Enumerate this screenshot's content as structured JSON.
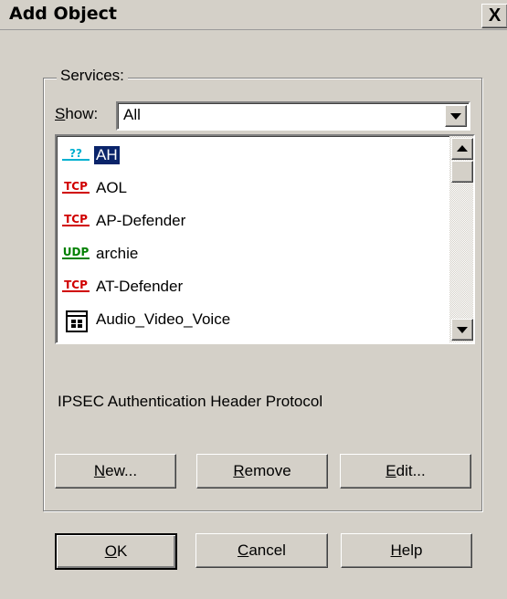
{
  "window": {
    "title": "Add Object",
    "close_label": "X"
  },
  "group": {
    "label": "Services:"
  },
  "show": {
    "label_underlined": "S",
    "label_rest": "how:",
    "value": "All"
  },
  "list": {
    "items": [
      {
        "proto": "??",
        "kind": "unk",
        "label": "AH",
        "selected": true
      },
      {
        "proto": "TCP",
        "kind": "tcp",
        "label": "AOL"
      },
      {
        "proto": "TCP",
        "kind": "tcp",
        "label": "AP-Defender"
      },
      {
        "proto": "UDP",
        "kind": "udp",
        "label": "archie"
      },
      {
        "proto": "TCP",
        "kind": "tcp",
        "label": "AT-Defender"
      },
      {
        "proto": "",
        "kind": "group",
        "label": "Audio_Video_Voice"
      }
    ]
  },
  "description": "IPSEC Authentication Header Protocol",
  "buttons": {
    "new": {
      "u": "N",
      "rest": "ew..."
    },
    "remove": {
      "u": "R",
      "rest": "emove"
    },
    "edit": {
      "u": "E",
      "rest": "dit..."
    },
    "ok": {
      "u": "O",
      "rest": "K"
    },
    "cancel": {
      "u": "C",
      "rest": "ancel"
    },
    "help": {
      "u": "H",
      "rest": "elp"
    }
  },
  "colors": {
    "selection": "#0a246a",
    "tcp": "#d00000",
    "udp": "#008000",
    "unknown": "#00b0d0",
    "face": "#d4d0c8"
  }
}
